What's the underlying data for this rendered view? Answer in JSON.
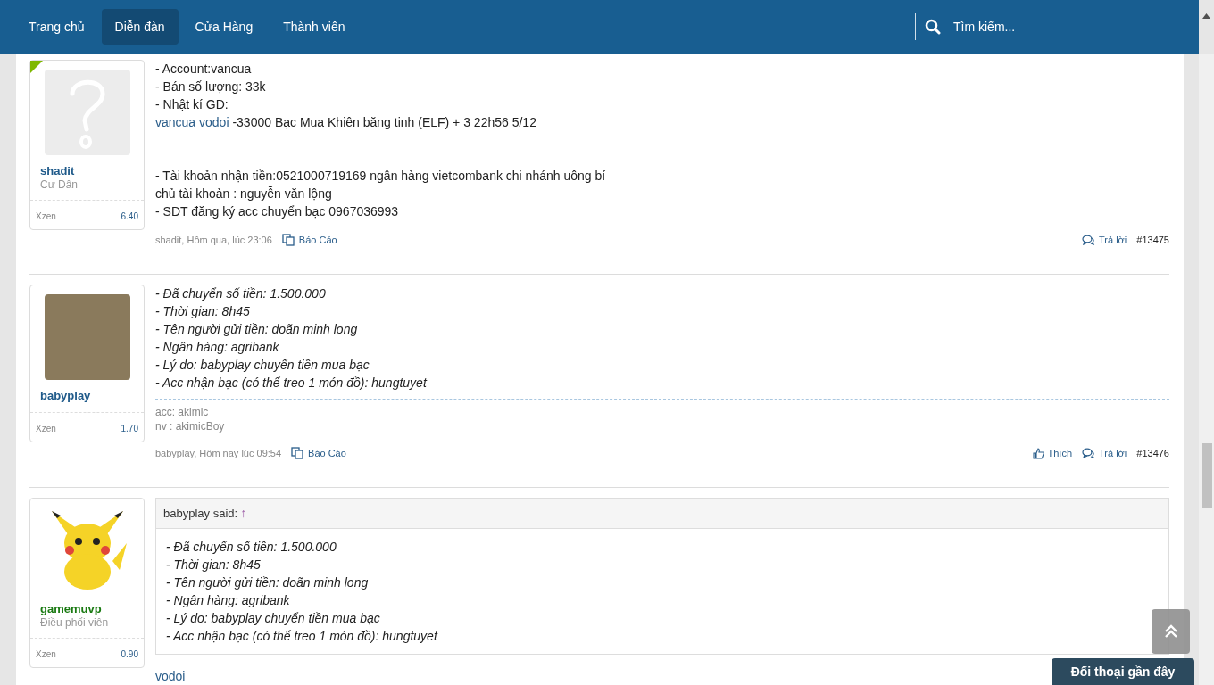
{
  "nav": {
    "items": [
      {
        "label": "Trang chủ",
        "selected": false
      },
      {
        "label": "Diễn đàn",
        "selected": true
      },
      {
        "label": "Cửa Hàng",
        "selected": false
      },
      {
        "label": "Thành viên",
        "selected": false
      }
    ],
    "search": {
      "placeholder": "Tìm kiếm..."
    }
  },
  "posts": [
    {
      "author": {
        "name": "shadit",
        "title": "Cư Dân",
        "color": "#1f5a8a",
        "online": true,
        "avatar": {
          "kind": "placeholder"
        }
      },
      "stat": {
        "label": "Xzen",
        "value": "6.40"
      },
      "italic": false,
      "paragraphs": [
        [
          {
            "text": "- Account:vancua"
          },
          {
            "text": "- Bán số lượng: 33k"
          },
          {
            "text": "- Nhật kí GD:"
          },
          {
            "link": "vancua vodoi",
            "text": " -33000 Bạc Mua Khiên băng tinh (ELF) + 3 22h56 5/12"
          }
        ],
        [
          {
            "text": "- Tài khoản nhận tiền:0521000719169 ngân hàng vietcombank chi nhánh uông bí"
          },
          {
            "text": "chủ tài khoản : nguyễn văn lộng"
          },
          {
            "text": "- SDT đăng ký acc chuyển bạc 0967036993"
          }
        ]
      ],
      "footer": {
        "meta": "shadit, Hôm qua, lúc 23:06",
        "report": "Báo Cáo",
        "reply": "Trả lời",
        "number": "#13475"
      }
    },
    {
      "author": {
        "name": "babyplay",
        "color": "#1f5a8a",
        "online": false,
        "avatar": {
          "kind": "photo"
        }
      },
      "stat": {
        "label": "Xzen",
        "value": "1.70"
      },
      "italic": true,
      "paragraphs": [
        [
          {
            "text": "- Đã chuyển số tiền: 1.500.000"
          },
          {
            "text": "- Thời gian: 8h45"
          },
          {
            "text": "- Tên người gửi tiền: doãn minh long"
          },
          {
            "text": "- Ngân hàng: agribank"
          },
          {
            "text": "- Lý do: babyplay chuyển tiền mua bạc"
          },
          {
            "text": "- Acc nhận bạc (có thể treo 1 món đồ): hungtuyet"
          }
        ]
      ],
      "signature": [
        "acc: akimic",
        "nv : akimicBoy"
      ],
      "footer": {
        "meta": "babyplay, Hôm nay lúc 09:54",
        "report": "Báo Cáo",
        "like": "Thích",
        "reply": "Trả lời",
        "number": "#13476"
      }
    },
    {
      "author": {
        "name": "gamemuvp",
        "title": "Điều phối viên",
        "color": "#1a7a12",
        "online": false,
        "avatar": {
          "kind": "cartoon"
        }
      },
      "stat": {
        "label": "Xzen",
        "value": "0.90"
      },
      "italic": false,
      "quote": {
        "said": "babyplay said:",
        "jump": "↑",
        "lines": [
          "- Đã chuyển số tiền: 1.500.000",
          "- Thời gian: 8h45",
          "- Tên người gửi tiền: doãn minh long",
          "- Ngân hàng: agribank",
          "- Lý do: babyplay chuyển tiền mua bạc",
          "- Acc nhận bạc (có thể treo 1 món đồ): hungtuyet"
        ]
      },
      "paragraphs": [
        [
          {
            "link": "vodoi"
          }
        ]
      ]
    }
  ],
  "chat_tab": "Đối thoại gần đây"
}
